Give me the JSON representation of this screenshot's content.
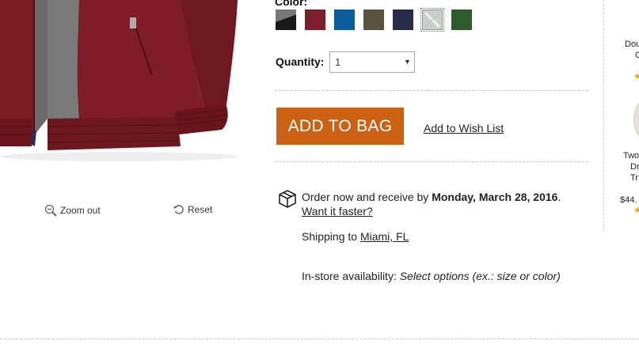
{
  "color_label": "Color:",
  "swatches": [
    {
      "name": "black-gray",
      "colors": [
        "#1a1a1a",
        "#777777"
      ]
    },
    {
      "name": "burgundy",
      "colors": [
        "#7a1f2b"
      ]
    },
    {
      "name": "blue",
      "colors": [
        "#0a5d9c"
      ]
    },
    {
      "name": "olive-brown",
      "colors": [
        "#5a5340"
      ]
    },
    {
      "name": "navy",
      "colors": [
        "#262b4a"
      ]
    },
    {
      "name": "light-gray",
      "colors": [
        "#c9d0cb"
      ],
      "selected": true
    },
    {
      "name": "green",
      "colors": [
        "#2f5a2c"
      ]
    }
  ],
  "quantity": {
    "label": "Quantity:",
    "value": "1"
  },
  "add_to_bag": "ADD TO BAG",
  "wish_list": "Add to Wish List",
  "delivery": {
    "prefix": "Order now and receive by ",
    "date": "Monday, March 28, 2016",
    "suffix": ".",
    "faster": "Want it faster?"
  },
  "shipping": {
    "prefix": "Shipping to ",
    "location": "Miami, FL"
  },
  "instore": {
    "label": "In-store availability: ",
    "value": "Select options (ex.: size or color)"
  },
  "zoom": {
    "zoom_out": "Zoom out",
    "reset": "Reset"
  },
  "right_rail": {
    "line1": "Dou",
    "line2": "C",
    "line3": "Two",
    "line4": "Dr",
    "line5": "Tr",
    "price": "$44."
  },
  "colors": {
    "accent": "#cc6114",
    "jacket": "#7b1b22",
    "star": "#f0a500"
  }
}
